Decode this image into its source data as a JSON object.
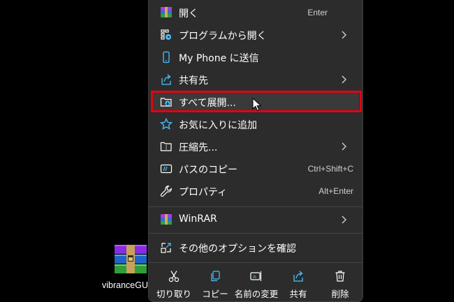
{
  "desktop": {
    "file_label": "vibranceGUI",
    "file_icon": "winrar-archive-icon"
  },
  "menu": {
    "items": [
      {
        "label": "開く",
        "shortcut": "Enter",
        "icon": "winrar-icon"
      },
      {
        "label": "プログラムから開く",
        "icon": "open-with-icon",
        "submenu": true
      },
      {
        "label": "My Phone に送信",
        "icon": "phone-icon"
      },
      {
        "label": "共有先",
        "icon": "share-icon",
        "submenu": true
      },
      {
        "label": "すべて展開...",
        "icon": "extract-all-icon",
        "highlighted": true
      },
      {
        "label": "お気に入りに追加",
        "icon": "star-icon"
      },
      {
        "label": "圧縮先...",
        "icon": "compress-icon",
        "submenu": true
      },
      {
        "label": "パスのコピー",
        "shortcut": "Ctrl+Shift+C",
        "icon": "copy-path-icon"
      },
      {
        "label": "プロパティ",
        "shortcut": "Alt+Enter",
        "icon": "wrench-icon"
      },
      {
        "label": "WinRAR",
        "icon": "winrar-icon",
        "submenu": true
      },
      {
        "label": "その他のオプションを確認",
        "icon": "more-options-icon"
      }
    ],
    "bottom_bar": [
      {
        "label": "切り取り",
        "icon": "scissors-icon"
      },
      {
        "label": "コピー",
        "icon": "copy-icon"
      },
      {
        "label": "名前の変更",
        "icon": "rename-icon"
      },
      {
        "label": "共有",
        "icon": "share-icon"
      },
      {
        "label": "削除",
        "icon": "trash-icon"
      }
    ]
  },
  "colors": {
    "menu_bg": "#2c2c2c",
    "highlight_border": "#e60012",
    "icon_blue": "#4cc2ff"
  }
}
